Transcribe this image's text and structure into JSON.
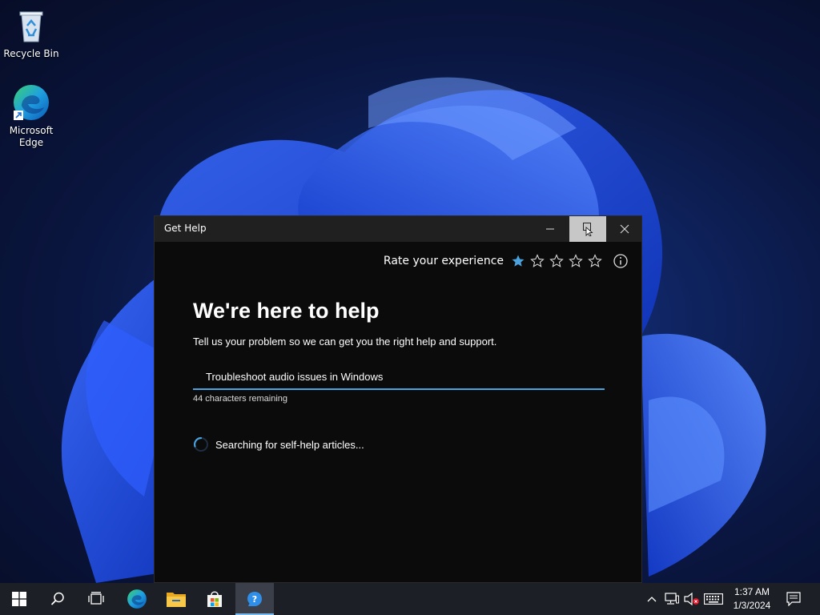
{
  "desktop": {
    "icons": [
      {
        "label": "Recycle Bin"
      },
      {
        "label": "Microsoft Edge"
      }
    ]
  },
  "window": {
    "title": "Get Help",
    "rating": {
      "label": "Rate your experience",
      "stars_total": 5,
      "stars_selected": 1,
      "accent": "#4aa3df"
    },
    "heading": "We're here to help",
    "subtext": "Tell us your problem so we can get you the right help and support.",
    "search": {
      "value": "Troubleshoot audio issues in Windows",
      "char_remaining": "44 characters remaining"
    },
    "status": "Searching for self-help articles..."
  },
  "taskbar": {
    "clock": {
      "time": "1:37 AM",
      "date": "1/3/2024"
    },
    "apps": [
      "start-icon",
      "search-icon",
      "task-view-icon",
      "edge-icon",
      "file-explorer-icon",
      "store-icon",
      "get-help-icon"
    ],
    "active_app": "get-help-icon"
  }
}
